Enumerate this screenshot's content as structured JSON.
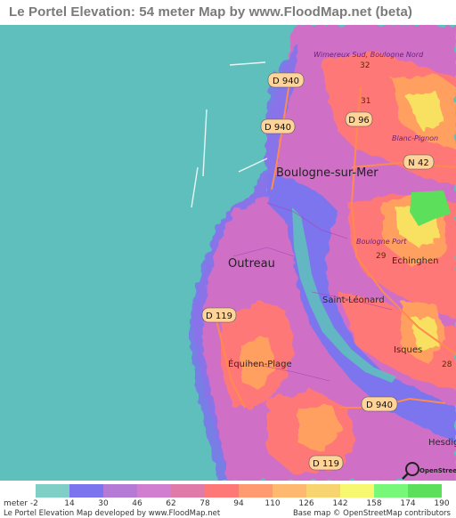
{
  "title": "Le Portel Elevation: 54 meter Map by www.FloodMap.net (beta)",
  "places": {
    "boulogne": "Boulogne-sur-Mer",
    "outreau": "Outreau",
    "saint_leonard": "Saint-Léonard",
    "equihen": "Équihen-Plage",
    "echinghen": "Echinghen",
    "isques": "Isques",
    "hesdig": "Hesdig",
    "wimereux": "Wimereux Sud, Boulogne Nord",
    "blanc_pignon": "Blanc-Pignon",
    "boulogne_port": "Boulogne Port"
  },
  "roads": {
    "d940_top": "D 940",
    "d940_mid": "D 940",
    "d96": "D 96",
    "n42": "N 42",
    "d119_left": "D 119",
    "d940_bottom": "D 940",
    "d119_bottom": "D 119",
    "r32": "32",
    "r31": "31",
    "r29": "29",
    "r28": "28"
  },
  "map_credit": "OpenStreetMap",
  "legend": {
    "unit_label": "meter",
    "values": [
      "-2",
      "14",
      "30",
      "46",
      "62",
      "78",
      "94",
      "110",
      "126",
      "142",
      "158",
      "174",
      "190"
    ],
    "colors": [
      "#7fcfc7",
      "#7b74ee",
      "#b57ad6",
      "#d17ed0",
      "#e07aa8",
      "#ff7878",
      "#ff9a70",
      "#ffb870",
      "#f8d470",
      "#f8f870",
      "#78f878",
      "#5ce05c"
    ]
  },
  "footer": {
    "left": "Le Portel Elevation Map developed by www.FloodMap.net",
    "right": "Base map © OpenStreetMap contributors"
  },
  "colors": {
    "sea": "#5fbfbd",
    "low": "#7b74ee",
    "mid": "#cf6fc6",
    "high": "#ff7878",
    "higher": "#ffa060",
    "peak": "#f8e060",
    "top": "#5ce05c"
  }
}
